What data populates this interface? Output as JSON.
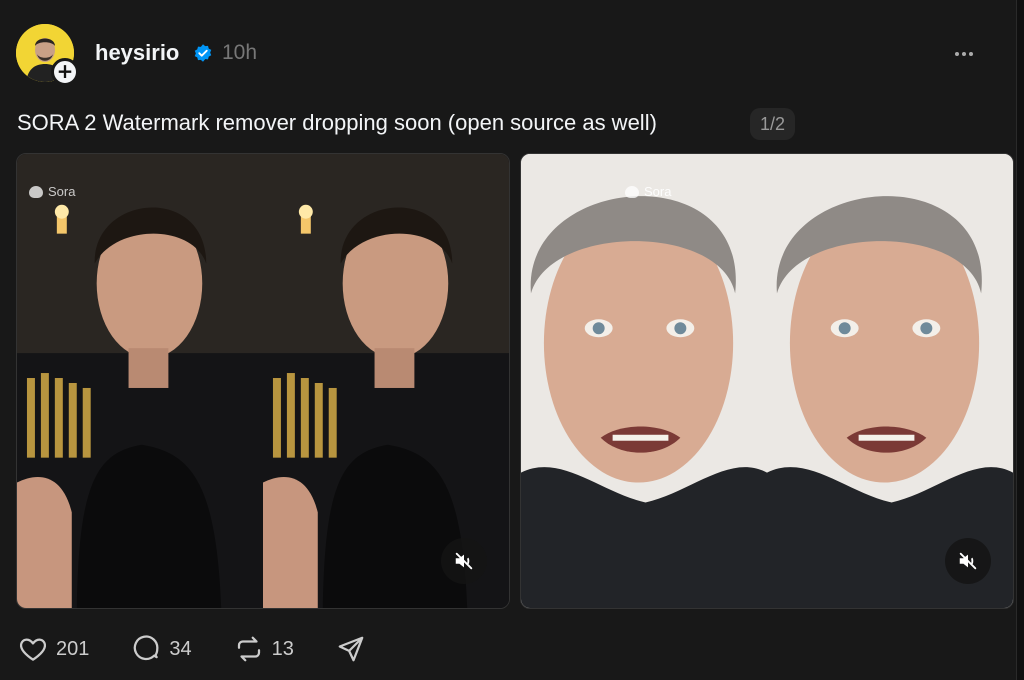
{
  "post": {
    "author": {
      "username": "heysirio",
      "verified": true,
      "avatar_icon": "avatar-photo",
      "follow_icon": "plus-icon"
    },
    "timestamp": "10h",
    "menu_icon": "more-icon",
    "text": "SORA 2 Watermark remover dropping soon (open source as well)",
    "page_indicator": "1/2",
    "media": [
      {
        "watermark": "Sora",
        "mute_icon": "muted-speaker-icon"
      },
      {
        "watermark": "Sora",
        "mute_icon": "muted-speaker-icon"
      }
    ],
    "actions": {
      "likes": "201",
      "comments": "34",
      "reposts": "13",
      "share_icon": "send-icon"
    }
  },
  "colors": {
    "background": "#181818",
    "text": "#f3f5f7",
    "muted": "#777777",
    "verified": "#0095f6",
    "avatar_bg": "#f2d534"
  }
}
